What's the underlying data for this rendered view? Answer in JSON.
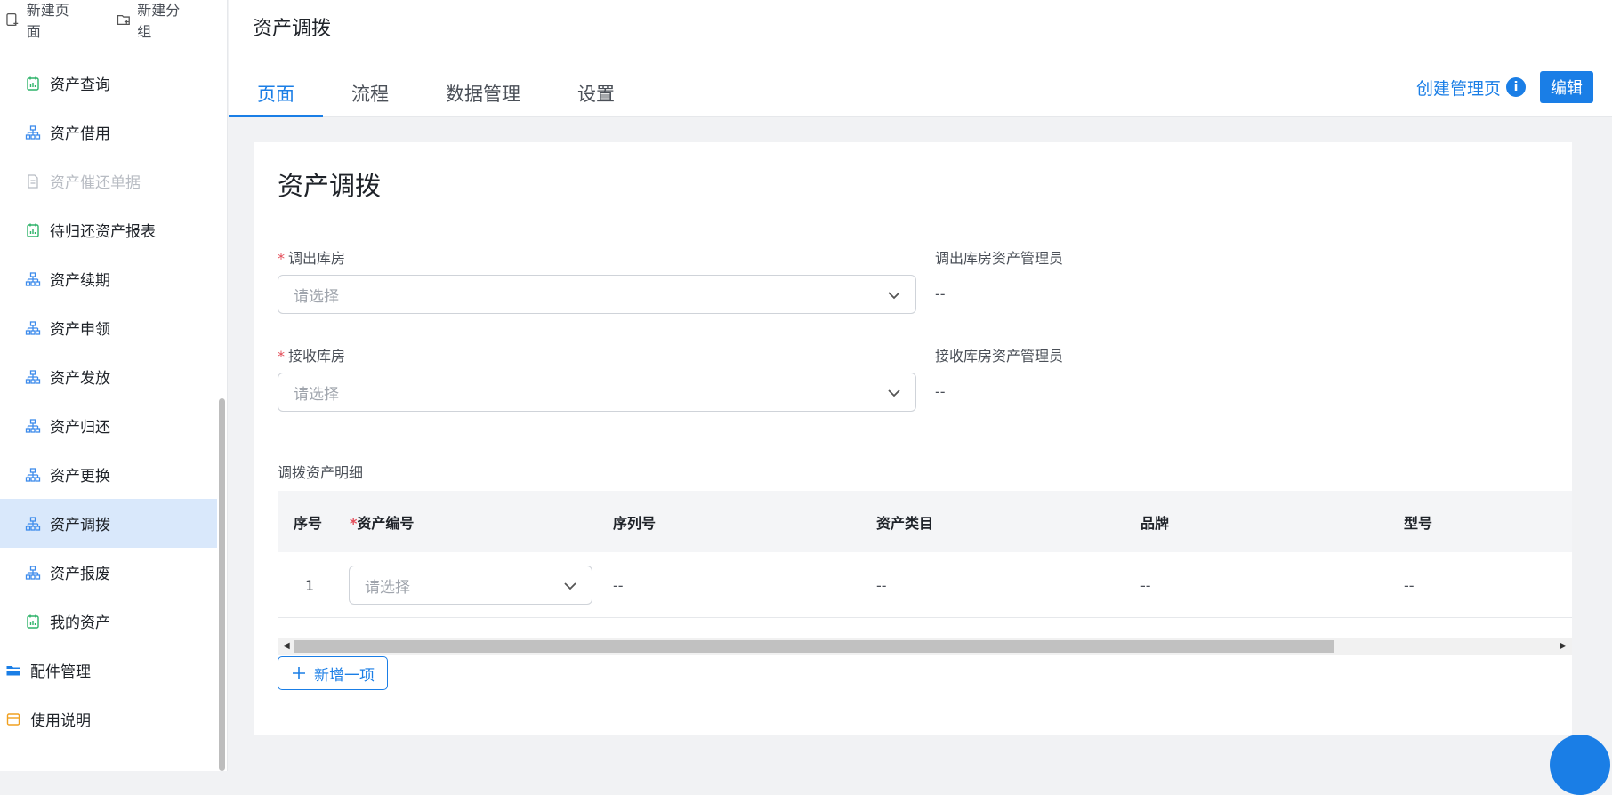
{
  "sidebar": {
    "new_page": "新建页面",
    "new_group": "新建分组",
    "items": [
      {
        "label": "资产查询",
        "icon": "report-icon",
        "state": "normal"
      },
      {
        "label": "资产借用",
        "icon": "flow-icon",
        "state": "normal"
      },
      {
        "label": "资产催还单据",
        "icon": "document-icon",
        "state": "disabled"
      },
      {
        "label": "待归还资产报表",
        "icon": "report-icon",
        "state": "normal"
      },
      {
        "label": "资产续期",
        "icon": "flow-icon",
        "state": "normal"
      },
      {
        "label": "资产申领",
        "icon": "flow-icon",
        "state": "normal"
      },
      {
        "label": "资产发放",
        "icon": "flow-icon",
        "state": "normal"
      },
      {
        "label": "资产归还",
        "icon": "flow-icon",
        "state": "normal"
      },
      {
        "label": "资产更换",
        "icon": "flow-icon",
        "state": "normal"
      },
      {
        "label": "资产调拨",
        "icon": "flow-icon",
        "state": "active"
      },
      {
        "label": "资产报废",
        "icon": "flow-icon",
        "state": "normal"
      },
      {
        "label": "我的资产",
        "icon": "report-icon",
        "state": "normal"
      },
      {
        "label": "配件管理",
        "icon": "folder-icon",
        "state": "folder"
      },
      {
        "label": "使用说明",
        "icon": "page-icon",
        "state": "folder"
      }
    ]
  },
  "header": {
    "app_title": "资产调拨",
    "tabs": [
      "页面",
      "流程",
      "数据管理",
      "设置"
    ],
    "create_admin_page": "创建管理页",
    "info": "i",
    "edit": "编辑"
  },
  "form": {
    "title": "资产调拨",
    "out_warehouse_label": "调出库房",
    "out_warehouse_placeholder": "请选择",
    "out_admin_label": "调出库房资产管理员",
    "out_admin_value": "--",
    "in_warehouse_label": "接收库房",
    "in_warehouse_placeholder": "请选择",
    "in_admin_label": "接收库房资产管理员",
    "in_admin_value": "--",
    "detail_label": "调拨资产明细",
    "table": {
      "headers": [
        "序号",
        "资产编号",
        "序列号",
        "资产类目",
        "品牌",
        "型号"
      ],
      "rows": [
        {
          "index": "1",
          "asset_no_placeholder": "请选择",
          "serial": "--",
          "category": "--",
          "brand": "--",
          "model": "--"
        }
      ]
    },
    "add_item": "新增一项"
  },
  "colors": {
    "accent": "#1a7ee6",
    "required": "#e34d59",
    "active_bg": "#d9e8fb"
  }
}
